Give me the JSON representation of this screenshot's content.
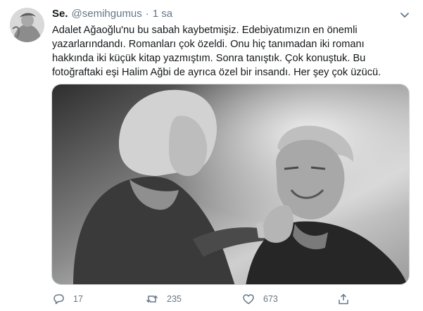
{
  "tweet": {
    "display_name": "Se.",
    "handle": "@semihgumus",
    "separator": "·",
    "time": "1 sa",
    "text_lines": [
      "Adalet Ağaoğlu'nu bu sabah kaybetmişiz. Edebiyatımızın en önemli",
      "yazarlarındandı. Romanları çok özeldi. Onu hiç tanımadan iki romanı",
      "hakkında iki küçük kitap yazmıştım. Sonra tanıştık. Çok konuştuk. Bu",
      "fotoğraftaki eşi Halim Ağbi de ayrıca özel bir insandı. Her şey çok üzücü."
    ],
    "media": {
      "type": "photo",
      "style": "black-and-white"
    },
    "actions": {
      "reply": {
        "icon": "reply-icon",
        "count": "17"
      },
      "retweet": {
        "icon": "retweet-icon",
        "count": "235"
      },
      "like": {
        "icon": "heart-icon",
        "count": "673"
      },
      "share": {
        "icon": "share-icon"
      }
    }
  },
  "colors": {
    "text": "#14171a",
    "secondary": "#657786",
    "border": "#ccd6dd"
  }
}
